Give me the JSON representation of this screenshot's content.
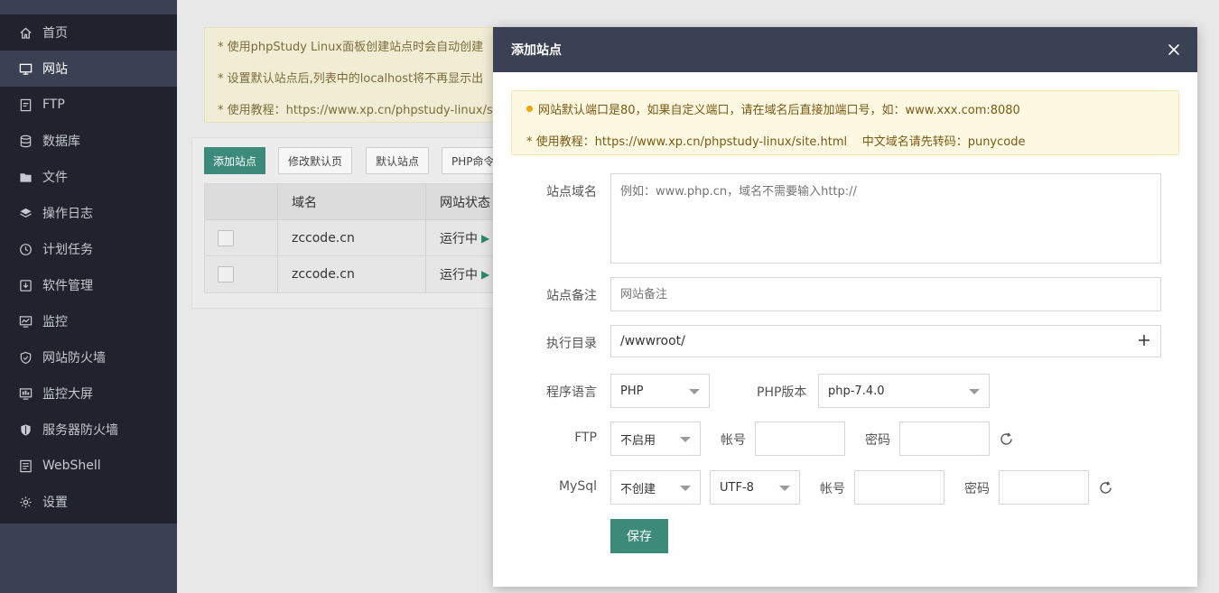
{
  "sidebar": {
    "items": [
      {
        "label": "首页",
        "icon": "home-icon",
        "active": false
      },
      {
        "label": "网站",
        "icon": "monitor-icon",
        "active": true
      },
      {
        "label": "FTP",
        "icon": "ftp-icon",
        "active": false
      },
      {
        "label": "数据库",
        "icon": "database-icon",
        "active": false
      },
      {
        "label": "文件",
        "icon": "folder-icon",
        "active": false
      },
      {
        "label": "操作日志",
        "icon": "layers-icon",
        "active": false
      },
      {
        "label": "计划任务",
        "icon": "clock-icon",
        "active": false
      },
      {
        "label": "软件管理",
        "icon": "package-icon",
        "active": false
      },
      {
        "label": "监控",
        "icon": "chart-monitor-icon",
        "active": false
      },
      {
        "label": "网站防火墙",
        "icon": "shield-icon",
        "active": false
      },
      {
        "label": "监控大屏",
        "icon": "dashboard-icon",
        "active": false
      },
      {
        "label": "服务器防火墙",
        "icon": "server-shield-icon",
        "active": false
      },
      {
        "label": "WebShell",
        "icon": "terminal-icon",
        "active": false
      },
      {
        "label": "设置",
        "icon": "gear-icon",
        "active": false
      }
    ]
  },
  "background": {
    "tips": [
      "* 使用phpStudy Linux面板创建站点时会自动创建",
      "* 设置默认站点后,列表中的localhost将不再显示出",
      "* 使用教程：https://www.xp.cn/phpstudy-linux/s"
    ],
    "buttons": [
      "添加站点",
      "修改默认页",
      "默认站点",
      "PHP命令"
    ],
    "table": {
      "headers": [
        "域名",
        "网站状态"
      ],
      "rows": [
        {
          "domain": "zccode.cn",
          "status": "运行中"
        },
        {
          "domain": "zccode.cn",
          "status": "运行中"
        }
      ]
    }
  },
  "modal": {
    "title": "添加站点",
    "notice": {
      "line1": "网站默认端口是80，如果自定义端口，请在域名后直接加端口号，如：www.xxx.com:8080",
      "line2": "* 使用教程：https://www.xp.cn/phpstudy-linux/site.html    中文域名请先转码：punycode"
    },
    "form": {
      "domain_label": "站点域名",
      "domain_placeholder": "例如：www.php.cn，域名不需要输入http://",
      "remark_label": "站点备注",
      "remark_placeholder": "网站备注",
      "dir_label": "执行目录",
      "dir_value": "/wwwroot/",
      "lang_label": "程序语言",
      "lang_value": "PHP",
      "php_version_label": "PHP版本",
      "php_version_value": "php-7.4.0",
      "ftp_label": "FTP",
      "ftp_value": "不启用",
      "ftp_account_label": "帐号",
      "ftp_password_label": "密码",
      "mysql_label": "MySql",
      "mysql_value": "不创建",
      "mysql_charset": "UTF-8",
      "mysql_account_label": "帐号",
      "mysql_password_label": "密码",
      "save_label": "保存"
    }
  },
  "colors": {
    "sidebar_bg": "#20232d",
    "sidebar_active": "#3a4152",
    "header_bg": "#3a4152",
    "accent_green": "#3c8a7a",
    "notice_bg": "#fdf8e2"
  }
}
